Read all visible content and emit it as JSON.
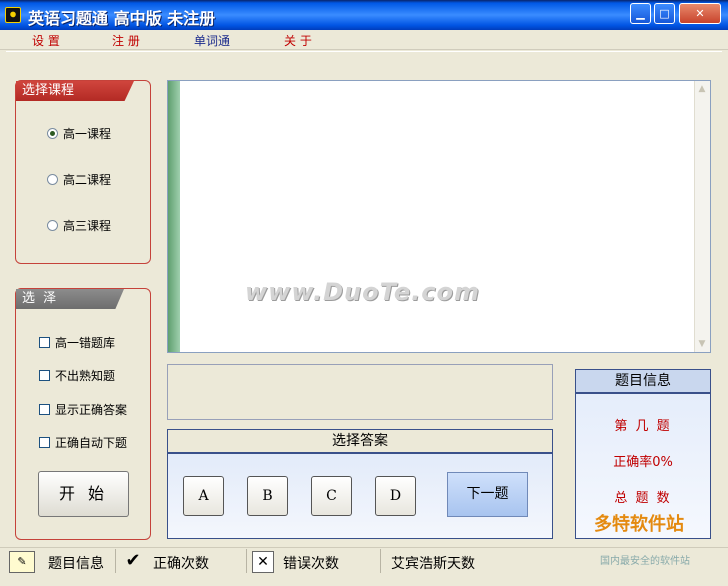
{
  "window": {
    "title": "英语习题通 高中版 未注册",
    "minimize": "▁",
    "maximize": "□",
    "close": "✕"
  },
  "menu": [
    "设 置",
    "注 册",
    "单词通",
    "关 于"
  ],
  "course_group": {
    "title": "选择课程",
    "options": [
      {
        "label": "高一课程",
        "selected": true
      },
      {
        "label": "高二课程",
        "selected": false
      },
      {
        "label": "高三课程",
        "selected": false
      }
    ]
  },
  "select_group": {
    "title": "选 泽",
    "options": [
      {
        "label": "高一错题库",
        "checked": false
      },
      {
        "label": "不出熟知题",
        "checked": false
      },
      {
        "label": "显示正确答案",
        "checked": false
      },
      {
        "label": "正确自动下题",
        "checked": false
      }
    ],
    "start_label": "开 始"
  },
  "watermark": "www.DuoTe.com",
  "answer_panel": {
    "title": "选择答案",
    "choices": [
      "A",
      "B",
      "C",
      "D"
    ],
    "next_label": "下一题"
  },
  "info_panel": {
    "title": "题目信息",
    "lines": [
      "第 几 题",
      "正确率0%",
      "总 题 数"
    ]
  },
  "statusbar": {
    "items": [
      {
        "icon": "✎",
        "label": "题目信息"
      },
      {
        "icon": "✔",
        "label": "正确次数"
      },
      {
        "icon": "✕",
        "label": "错误次数"
      },
      {
        "icon": "",
        "label": "艾宾浩斯天数"
      }
    ]
  },
  "corner_logo": {
    "main": "多特软件站",
    "sub": "国内最安全的软件站"
  },
  "colors": {
    "accent_red": "#c5423a",
    "panel_blue": "#39508a",
    "titlebar_blue": "#0054e3"
  }
}
